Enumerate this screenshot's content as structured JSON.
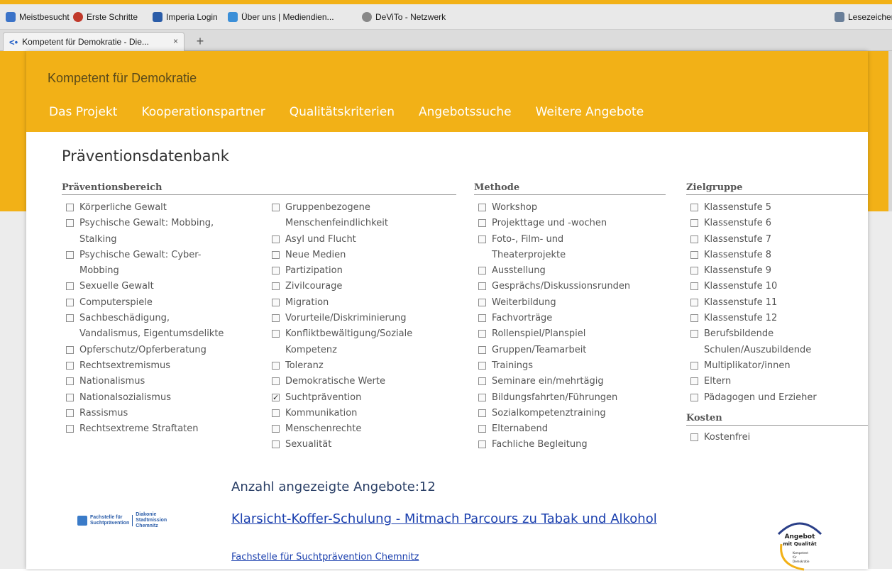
{
  "browser": {
    "bookmarks": [
      {
        "label": "Meistbesucht",
        "icon": "most-visited-icon",
        "color": "#3b73c8"
      },
      {
        "label": "Erste Schritte",
        "icon": "firefox-icon",
        "color": "#c0392b"
      },
      {
        "label": "Imperia Login",
        "icon": "imperia-icon",
        "color": "#2a5ca8"
      },
      {
        "label": "Über uns | Mediendien...",
        "icon": "media-icon",
        "color": "#3b8fd8"
      },
      {
        "label": "DeViTo - Netzwerk",
        "icon": "globe-icon",
        "color": "#888888"
      }
    ],
    "bookmarks_right": "Lesezeichen",
    "tab_title": "Kompetent für Demokratie - Die...",
    "tab_close": "×",
    "new_tab": "+"
  },
  "site": {
    "title": "Kompetent für Demokratie",
    "nav": [
      "Das Projekt",
      "Kooperationspartner",
      "Qualitätskriterien",
      "Angebotssuche",
      "Weitere Angebote"
    ]
  },
  "main": {
    "page_title": "Präventionsdatenbank",
    "praevention": {
      "header": "Präventionsbereich",
      "col1": [
        {
          "lines": [
            "Körperliche Gewalt"
          ],
          "checked": false
        },
        {
          "lines": [
            "Psychische Gewalt: Mobbing,",
            "Stalking"
          ],
          "checked": false
        },
        {
          "lines": [
            "Psychische Gewalt: Cyber-",
            "Mobbing"
          ],
          "checked": false
        },
        {
          "lines": [
            "Sexuelle Gewalt"
          ],
          "checked": false
        },
        {
          "lines": [
            "Computerspiele"
          ],
          "checked": false
        },
        {
          "lines": [
            "Sachbeschädigung,",
            "Vandalismus, Eigentumsdelikte"
          ],
          "checked": false
        },
        {
          "lines": [
            "Opferschutz/Opferberatung"
          ],
          "checked": false
        },
        {
          "lines": [
            "Rechtsextremismus"
          ],
          "checked": false
        },
        {
          "lines": [
            "Nationalismus"
          ],
          "checked": false
        },
        {
          "lines": [
            "Nationalsozialismus"
          ],
          "checked": false
        },
        {
          "lines": [
            "Rassismus"
          ],
          "checked": false
        },
        {
          "lines": [
            "Rechtsextreme Straftaten"
          ],
          "checked": false
        }
      ],
      "col2": [
        {
          "lines": [
            "Gruppenbezogene",
            "Menschenfeindlichkeit"
          ],
          "checked": false
        },
        {
          "lines": [
            "Asyl und Flucht"
          ],
          "checked": false
        },
        {
          "lines": [
            "Neue Medien"
          ],
          "checked": false
        },
        {
          "lines": [
            "Partizipation"
          ],
          "checked": false
        },
        {
          "lines": [
            "Zivilcourage"
          ],
          "checked": false
        },
        {
          "lines": [
            "Migration"
          ],
          "checked": false
        },
        {
          "lines": [
            "Vorurteile/Diskriminierung"
          ],
          "checked": false
        },
        {
          "lines": [
            "Konfliktbewältigung/Soziale",
            "Kompetenz"
          ],
          "checked": false
        },
        {
          "lines": [
            "Toleranz"
          ],
          "checked": false
        },
        {
          "lines": [
            "Demokratische Werte"
          ],
          "checked": false
        },
        {
          "lines": [
            "Suchtprävention"
          ],
          "checked": true
        },
        {
          "lines": [
            "Kommunikation"
          ],
          "checked": false
        },
        {
          "lines": [
            "Menschenrechte"
          ],
          "checked": false
        },
        {
          "lines": [
            "Sexualität"
          ],
          "checked": false
        }
      ]
    },
    "methode": {
      "header": "Methode",
      "items": [
        {
          "lines": [
            "Workshop"
          ],
          "checked": false
        },
        {
          "lines": [
            "Projekttage und -wochen"
          ],
          "checked": false
        },
        {
          "lines": [
            "Foto-, Film- und",
            "Theaterprojekte"
          ],
          "checked": false
        },
        {
          "lines": [
            "Ausstellung"
          ],
          "checked": false
        },
        {
          "lines": [
            "Gesprächs/Diskussionsrunden"
          ],
          "checked": false
        },
        {
          "lines": [
            "Weiterbildung"
          ],
          "checked": false
        },
        {
          "lines": [
            "Fachvorträge"
          ],
          "checked": false
        },
        {
          "lines": [
            "Rollenspiel/Planspiel"
          ],
          "checked": false
        },
        {
          "lines": [
            "Gruppen/Teamarbeit"
          ],
          "checked": false
        },
        {
          "lines": [
            "Trainings"
          ],
          "checked": false
        },
        {
          "lines": [
            "Seminare ein/mehrtägig"
          ],
          "checked": false
        },
        {
          "lines": [
            "Bildungsfahrten/Führungen"
          ],
          "checked": false
        },
        {
          "lines": [
            "Sozialkompetenztraining"
          ],
          "checked": false
        },
        {
          "lines": [
            "Elternabend"
          ],
          "checked": false
        },
        {
          "lines": [
            "Fachliche Begleitung"
          ],
          "checked": false
        }
      ]
    },
    "zielgruppe": {
      "header": "Zielgruppe",
      "items": [
        {
          "lines": [
            "Klassenstufe 5"
          ],
          "checked": false
        },
        {
          "lines": [
            "Klassenstufe 6"
          ],
          "checked": false
        },
        {
          "lines": [
            "Klassenstufe 7"
          ],
          "checked": false
        },
        {
          "lines": [
            "Klassenstufe 8"
          ],
          "checked": false
        },
        {
          "lines": [
            "Klassenstufe 9"
          ],
          "checked": false
        },
        {
          "lines": [
            "Klassenstufe 10"
          ],
          "checked": false
        },
        {
          "lines": [
            "Klassenstufe 11"
          ],
          "checked": false
        },
        {
          "lines": [
            "Klassenstufe 12"
          ],
          "checked": false
        },
        {
          "lines": [
            "Berufsbildende",
            "Schulen/Auszubildende"
          ],
          "checked": false
        },
        {
          "lines": [
            "Multiplikator/innen"
          ],
          "checked": false
        },
        {
          "lines": [
            "Eltern"
          ],
          "checked": false
        },
        {
          "lines": [
            "Pädagogen und Erzieher"
          ],
          "checked": false
        }
      ]
    },
    "kosten": {
      "header": "Kosten",
      "items": [
        {
          "lines": [
            "Kostenfrei"
          ],
          "checked": false
        }
      ]
    },
    "results": {
      "count_label": "Anzahl angezeigte Angebote:12",
      "first": {
        "title": "Klarsicht-Koffer-Schulung - Mitmach Parcours zu Tabak und Alkohol",
        "org": "Fachstelle für Suchtprävention Chemnitz",
        "org_logo_left": [
          "Fachstelle für",
          "Suchtprävention"
        ],
        "org_logo_right": [
          "Diakonie",
          "Stadtmission",
          "Chemnitz"
        ],
        "quality_logo": [
          "Angebot",
          "mit Qualität",
          "Kompetent",
          "für",
          "Demokratie"
        ]
      }
    }
  },
  "colors": {
    "brand_orange": "#f2b117",
    "link_blue": "#1a3fae"
  }
}
